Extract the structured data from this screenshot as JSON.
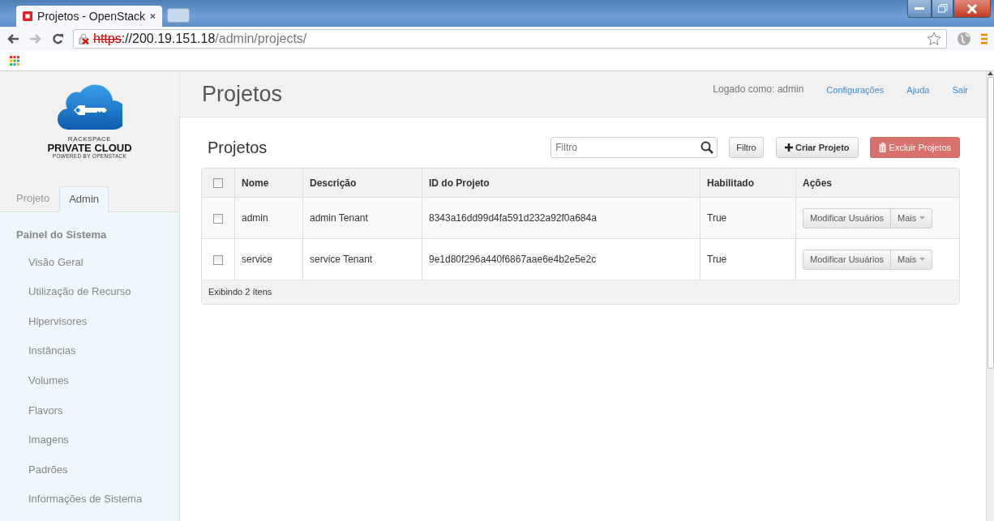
{
  "browser": {
    "tab_title": "Projetos - OpenStack",
    "url_scheme": "https",
    "url_host": "://200.19.151.18",
    "url_path": "/admin/projects/"
  },
  "logo": {
    "brand": "RACKSPACE",
    "product": "PRIVATE CLOUD",
    "tagline": "POWERED BY OPENSTACK"
  },
  "sidebar": {
    "tabs": [
      {
        "label": "Projeto",
        "selected": false
      },
      {
        "label": "Admin",
        "selected": true
      }
    ],
    "panel_title": "Painel do Sistema",
    "items": [
      {
        "label": "Visão Geral",
        "selected": false
      },
      {
        "label": "Utilização de Recurso",
        "selected": false
      },
      {
        "label": "Hipervisores",
        "selected": false
      },
      {
        "label": "Instâncias",
        "selected": false
      },
      {
        "label": "Volumes",
        "selected": false
      },
      {
        "label": "Flavors",
        "selected": false
      },
      {
        "label": "Imagens",
        "selected": false
      },
      {
        "label": "Padrões",
        "selected": false
      },
      {
        "label": "Informações de Sistema",
        "selected": false
      }
    ]
  },
  "header": {
    "title": "Projetos",
    "user": "Logado como: admin",
    "links": [
      "Configurações",
      "Ajuda",
      "Sair"
    ]
  },
  "table_section": {
    "title": "Projetos",
    "filter": {
      "placeholder": "Filtro"
    },
    "filter_button": "Filtro",
    "create_button": "Criar Projeto",
    "delete_button": "Excluir Projetos",
    "columns": [
      "Nome",
      "Descrição",
      "ID do Projeto",
      "Habilitado",
      "Ações"
    ],
    "select_all_checked": false,
    "rows": [
      {
        "checked": false,
        "name": "admin",
        "description": "admin Tenant",
        "id": "8343a16dd99d4fa591d232a92f0a684a",
        "enabled": "True",
        "action": "Modificar Usuários",
        "more": "Mais"
      },
      {
        "checked": false,
        "name": "service",
        "description": "service Tenant",
        "id": "9e1d80f296a440f6867aae6e4b2e5e2c",
        "enabled": "True",
        "action": "Modificar Usuários",
        "more": "Mais"
      }
    ],
    "footer": "Exibindo 2 ítens"
  }
}
